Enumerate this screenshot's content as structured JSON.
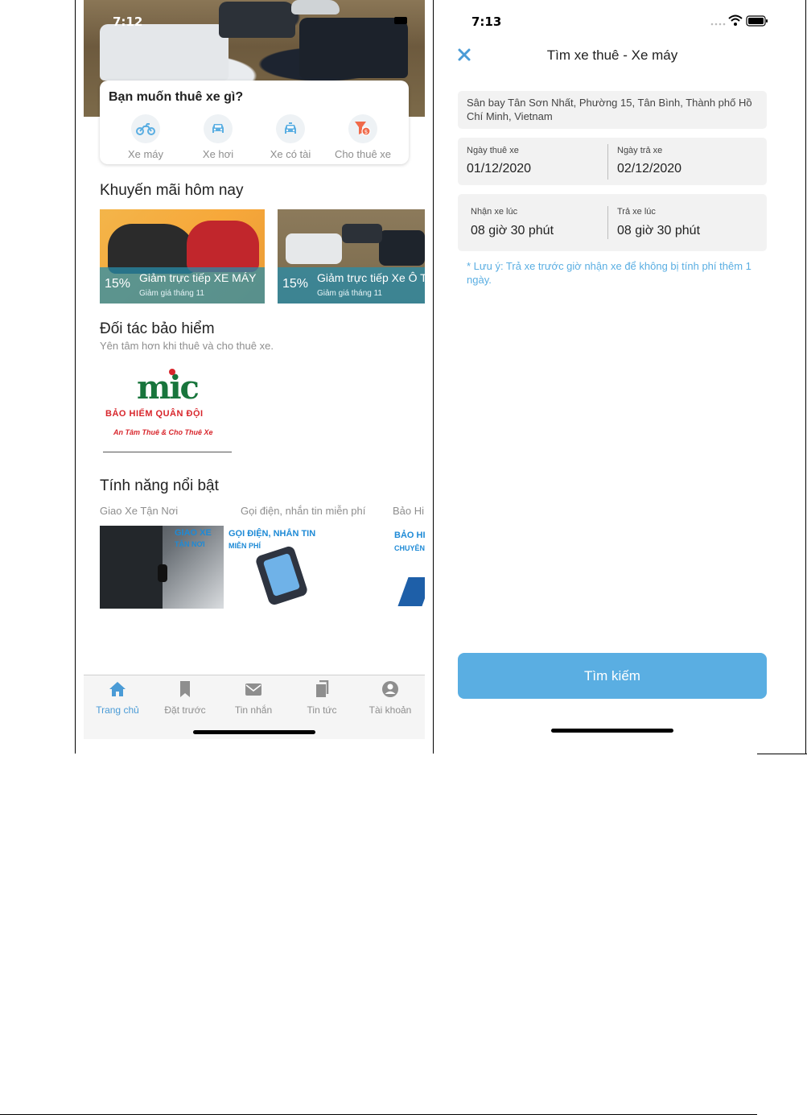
{
  "left": {
    "status_time": "7:12",
    "rent_card_title": "Bạn muốn thuê xe gì?",
    "vehicles": [
      {
        "label": "Xe máy",
        "icon": "motorbike-icon"
      },
      {
        "label": "Xe hơi",
        "icon": "car-icon"
      },
      {
        "label": "Xe có tài",
        "icon": "car-driver-icon"
      },
      {
        "label": "Cho thuê xe",
        "icon": "rent-out-filter-icon"
      }
    ],
    "promo_section_title": "Khuyến mãi hôm nay",
    "promos": [
      {
        "percent": "15%",
        "title": "Giảm trực tiếp XE MÁY",
        "subtitle": "Giảm giá tháng 11"
      },
      {
        "percent": "15%",
        "title": "Giảm trực tiếp Xe Ô T",
        "subtitle": "Giảm giá tháng 11"
      }
    ],
    "insurance_title": "Đối tác bảo hiểm",
    "insurance_subtitle": "Yên tâm hơn khi thuê và cho thuê xe.",
    "insurance_logo": {
      "mark": "mic",
      "name": "BẢO HIỂM QUÂN ĐỘI",
      "tagline": "An Tâm Thuê & Cho Thuê Xe"
    },
    "features_title": "Tính năng nổi bật",
    "features": [
      {
        "label": "Giao Xe Tận Nơi",
        "img_line1": "GIAO XE",
        "img_line2": "TẬN NƠI"
      },
      {
        "label": "Gọi điện, nhắn tin miễn phí",
        "img_line1": "GỌI ĐIỆN, NHẮN TIN",
        "img_line2": "MIỄN PHÍ"
      },
      {
        "label": "Bảo Hi",
        "img_line1": "BẢO HI",
        "img_line2": "CHUYÊN"
      }
    ],
    "tabs": [
      {
        "label": "Trang chủ",
        "icon": "home-icon",
        "active": true
      },
      {
        "label": "Đặt trước",
        "icon": "bookmark-icon",
        "active": false
      },
      {
        "label": "Tin nhắn",
        "icon": "envelope-icon",
        "active": false
      },
      {
        "label": "Tin tức",
        "icon": "documents-icon",
        "active": false
      },
      {
        "label": "Tài khoản",
        "icon": "user-circle-icon",
        "active": false
      }
    ]
  },
  "right": {
    "status_time": "7:13",
    "nav_title": "Tìm xe thuê - Xe máy",
    "address": "Sân bay Tân Sơn Nhất, Phường 15, Tân Bình, Thành phố Hồ Chí Minh, Vietnam",
    "rent_date_label": "Ngày thuê xe",
    "rent_date_value": "01/12/2020",
    "return_date_label": "Ngày trả xe",
    "return_date_value": "02/12/2020",
    "pickup_time_label": "Nhận xe lúc",
    "pickup_time_value": "08 giờ 30 phút",
    "return_time_label": "Trả xe lúc",
    "return_time_value": "08 giờ 30 phút",
    "note": "* Lưu ý: Trả xe trước giờ nhận xe để không bị tính phí thêm 1 ngày.",
    "search_button": "Tìm kiếm"
  },
  "colors": {
    "accent": "#5aaee2",
    "tab_active": "#4a9bd6",
    "promo_band": "#288caa",
    "mic_green": "#18753c",
    "mic_red": "#d8262c"
  }
}
